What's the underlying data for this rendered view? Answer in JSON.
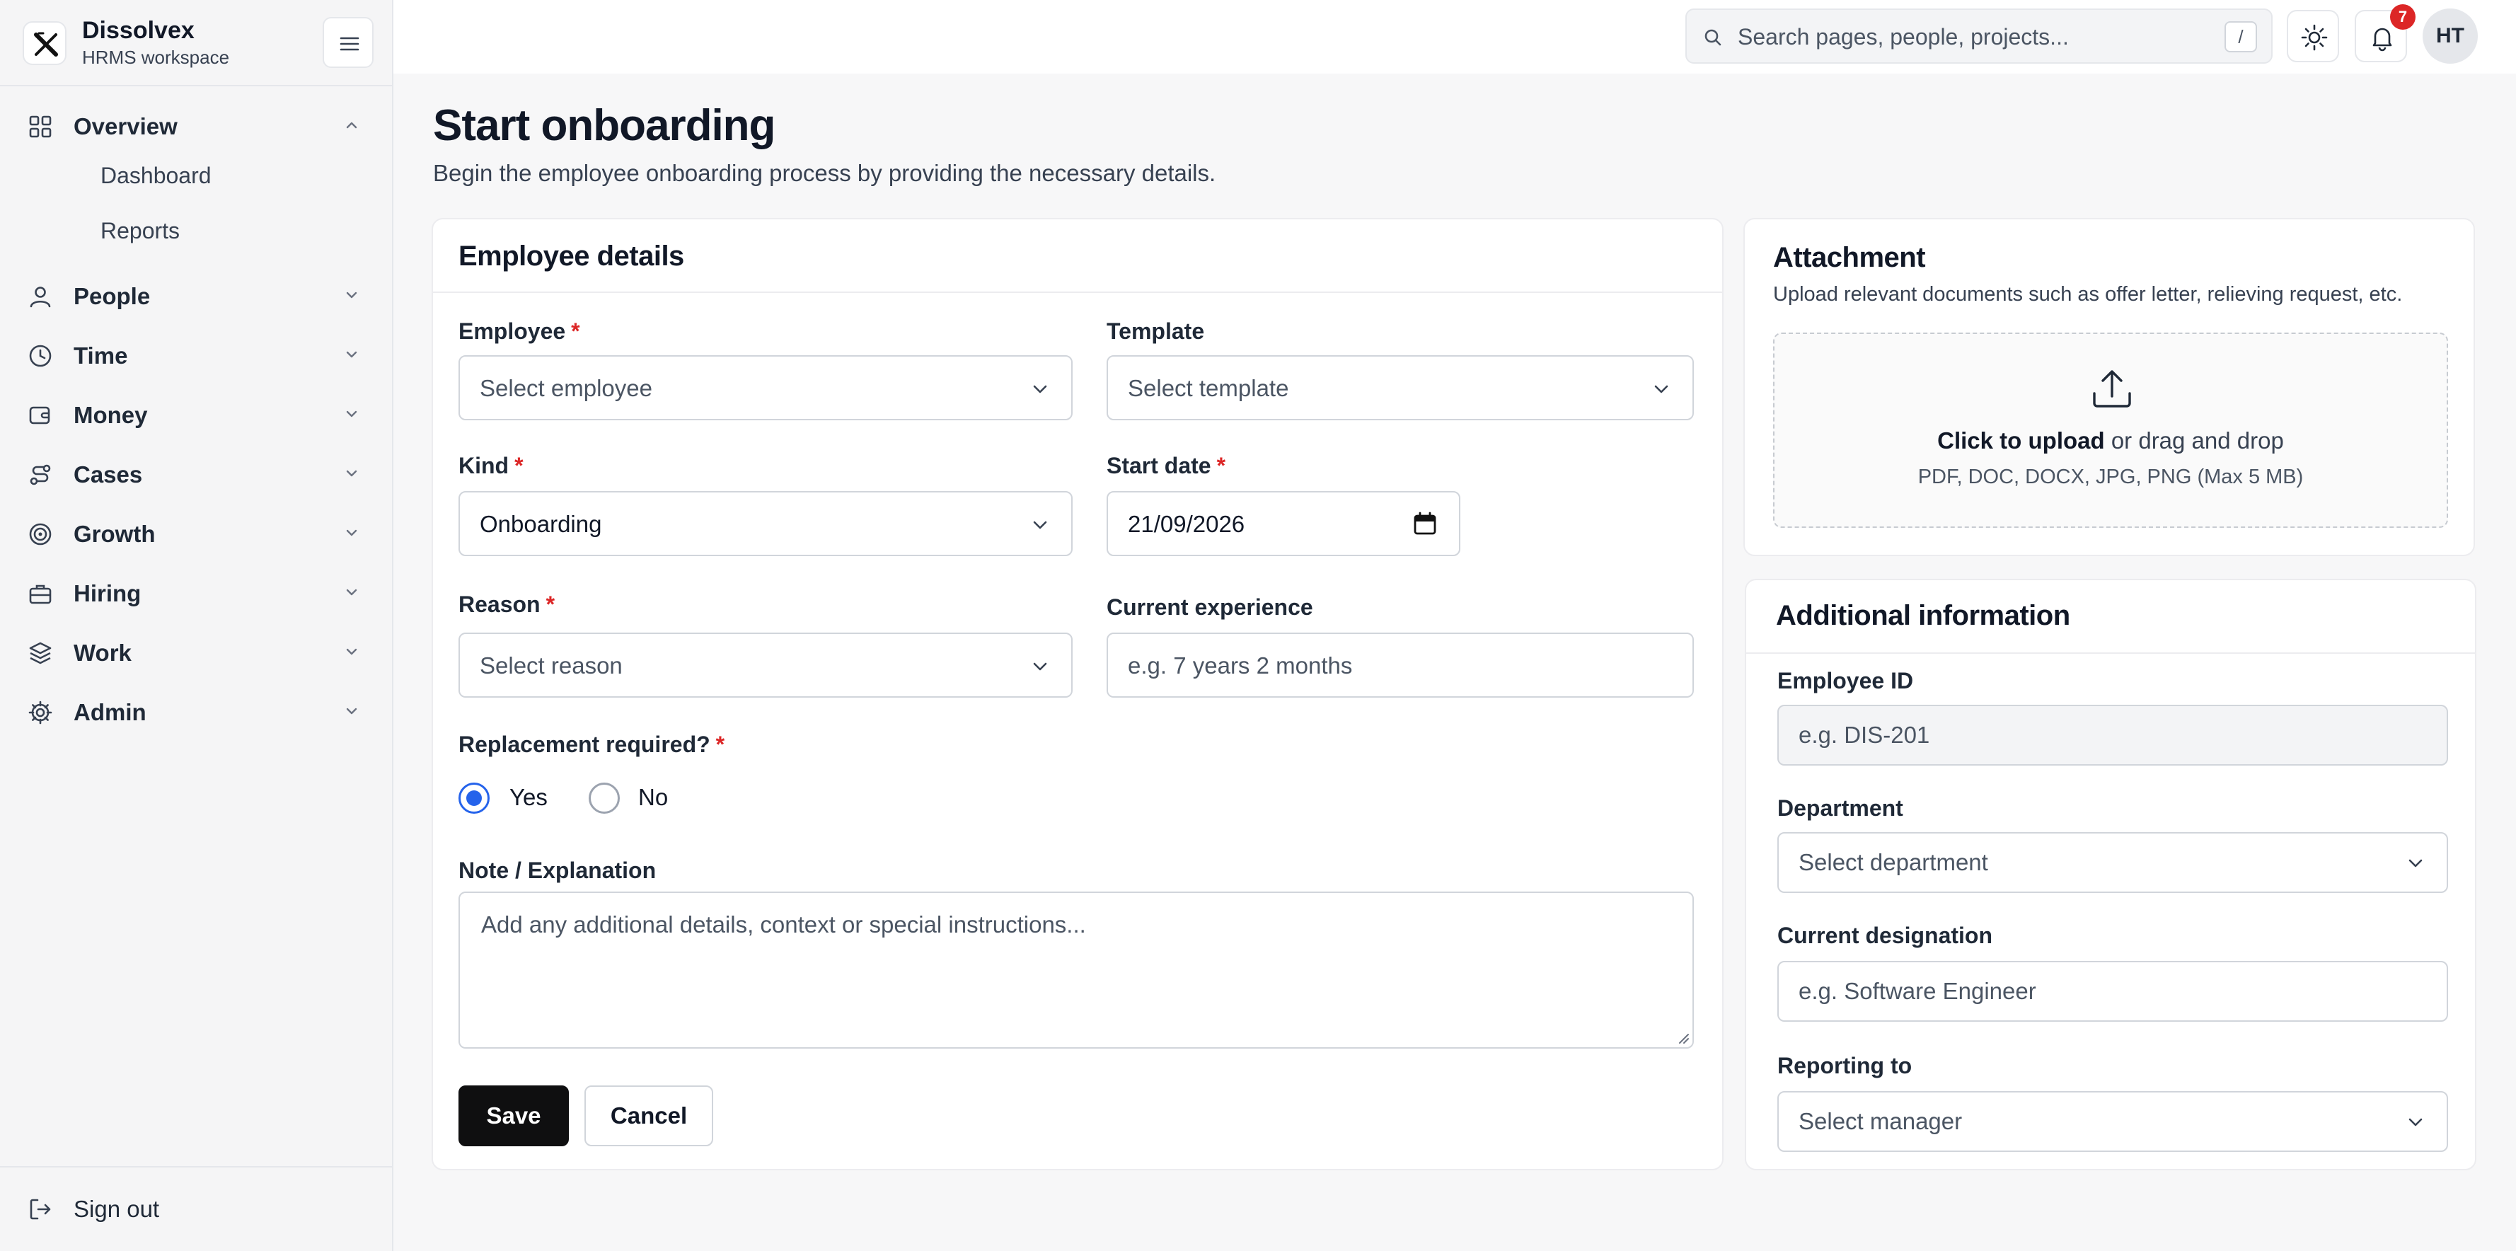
{
  "brand": {
    "name": "Dissolvex",
    "subtitle": "HRMS workspace"
  },
  "sidebar": {
    "items": [
      {
        "label": "Overview",
        "icon": "grid-icon",
        "expanded": true,
        "children": [
          {
            "label": "Dashboard"
          },
          {
            "label": "Reports"
          }
        ]
      },
      {
        "label": "People",
        "icon": "user-icon"
      },
      {
        "label": "Time",
        "icon": "clock-icon"
      },
      {
        "label": "Money",
        "icon": "wallet-icon"
      },
      {
        "label": "Cases",
        "icon": "route-icon"
      },
      {
        "label": "Growth",
        "icon": "target-icon"
      },
      {
        "label": "Hiring",
        "icon": "briefcase-icon"
      },
      {
        "label": "Work",
        "icon": "layers-icon"
      },
      {
        "label": "Admin",
        "icon": "gear-icon"
      }
    ],
    "signout": "Sign out"
  },
  "topbar": {
    "search_placeholder": "Search pages, people, projects...",
    "search_shortcut": "/",
    "notifications_count": "7",
    "avatar_initials": "HT"
  },
  "page": {
    "title": "Start onboarding",
    "subtitle": "Begin the employee onboarding process by providing the necessary details."
  },
  "employee_details": {
    "title": "Employee details",
    "employee": {
      "label": "Employee",
      "placeholder": "Select employee"
    },
    "template": {
      "label": "Template",
      "placeholder": "Select template"
    },
    "kind": {
      "label": "Kind",
      "value": "Onboarding"
    },
    "start_date": {
      "label": "Start date",
      "value": "21/09/2026"
    },
    "reason": {
      "label": "Reason",
      "placeholder": "Select reason"
    },
    "current_experience": {
      "label": "Current experience",
      "placeholder": "e.g. 7 years 2 months"
    },
    "replacement": {
      "label": "Replacement required?",
      "yes": "Yes",
      "no": "No",
      "selected": "Yes"
    },
    "note": {
      "label": "Note / Explanation",
      "placeholder": "Add any additional details, context or special instructions..."
    },
    "save": "Save",
    "cancel": "Cancel"
  },
  "attachment": {
    "title": "Attachment",
    "subtitle": "Upload relevant documents such as offer letter, relieving request, etc.",
    "click": "Click to upload",
    "drag": "or drag and drop",
    "formats": "PDF, DOC, DOCX, JPG, PNG (Max 5 MB)"
  },
  "additional": {
    "title": "Additional information",
    "employee_id": {
      "label": "Employee ID",
      "placeholder": "e.g. DIS-201"
    },
    "department": {
      "label": "Department",
      "placeholder": "Select department"
    },
    "designation": {
      "label": "Current designation",
      "placeholder": "e.g. Software Engineer"
    },
    "reporting": {
      "label": "Reporting to",
      "placeholder": "Select manager"
    }
  },
  "colors": {
    "accent": "#2563eb",
    "required": "#dc2626",
    "primary_button": "#0f0f10"
  }
}
